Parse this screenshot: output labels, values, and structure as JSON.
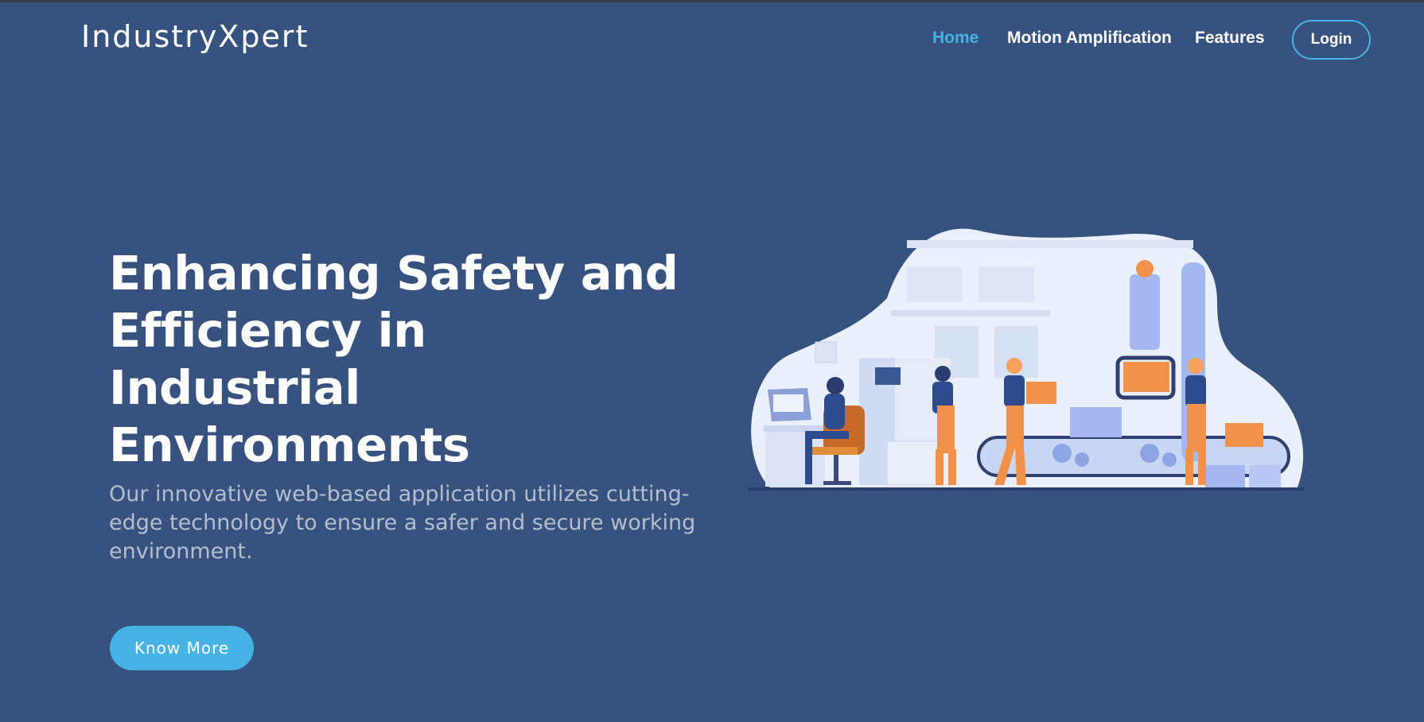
{
  "brand": {
    "name": "IndustryXpert"
  },
  "nav": {
    "items": [
      {
        "label": "Home",
        "active": true
      },
      {
        "label": "Motion Amplification",
        "active": false
      },
      {
        "label": "Features",
        "active": false
      }
    ],
    "login_label": "Login"
  },
  "hero": {
    "title": "Enhancing Safety and Efficiency in Industrial Environments",
    "subtitle": "Our innovative web-based application utilizes cutting-edge technology to ensure a safer and secure working environment.",
    "cta_label": "Know More"
  },
  "colors": {
    "background": "#37527e",
    "accent": "#47b2e4",
    "text": "#ffffff",
    "illustration_orange": "#f2914a",
    "illustration_blue": "#a6b8f2"
  },
  "illustration": {
    "name": "factory-workers-conveyor-illustration"
  }
}
